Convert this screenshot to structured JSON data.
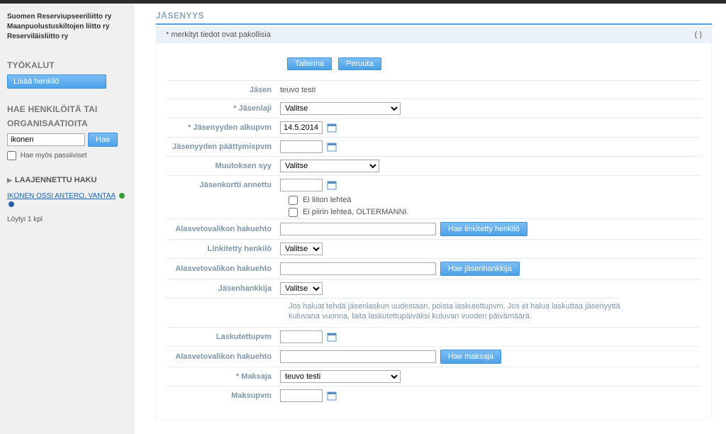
{
  "sidebar": {
    "orgs": [
      "Suomen Reserviupseeriliitto ry",
      "Maanpuolustuskiltojen liitto ry",
      "Reserviläisliitto ry"
    ],
    "tools_h": "TYÖKALUT",
    "add_person": "Lisää henkilö",
    "search_h1": "HAE HENKILÖITÄ TAI",
    "search_h2": "ORGANISAATIOITA",
    "search_value": "ikonen",
    "search_btn": "Hae",
    "passive_label": "Hae myös passiiviset",
    "advanced": "LAAJENNETTU HAKU",
    "result_link": "IKONEN OSSI ANTERO, VANTAA",
    "found": "Löytyi 1 kpl"
  },
  "page": {
    "title": "JÄSENYYS",
    "required_note": "* merkityt tiedot ovat pakollisia",
    "paren": "( )",
    "save": "Tallenna",
    "cancel": "Peruuta"
  },
  "labels": {
    "jasen": "Jäsen",
    "jasenlaji": "* Jäsenlaji",
    "alkupvm": "* Jäsenyyden alkupvm",
    "paattymispvm": "Jäsenyyden päättymispvm",
    "muutoksensyy": "Muutoksen syy",
    "kortti": "Jäsenkortti annettu",
    "alasveto": "Alasvetovalikon hakuehto",
    "linkitetty": "Linkitetty henkilö",
    "jasenhankkija": "Jäsenhankkija",
    "laskutettupvm": "Laskutettupvm",
    "maksaja": "* Maksaja",
    "maksupvm": "Maksupvm"
  },
  "values": {
    "jasen": "teuvo testi",
    "jasenlaji_sel": "Valitse",
    "alkupvm": "14.5.2014",
    "muutoksensyy_sel": "Valitse",
    "liiton_lehtea": "Ei liiton lehteä",
    "piirin_lehtea": "Ei piirin lehteä, OLTERMANNI.",
    "linkitetty_sel": "Valitse",
    "jasenhankkija_sel": "Valitse",
    "maksaja_sel": "teuvo testi",
    "note": "Jos haluat tehdä jäsenlaskun uudestaan, poista laskutettupvm. Jos et halua laskuttaa jäsenyyttä kuluvana vuonna, laita laskutettupäiväksi kuluvan vuoden päivämäärä."
  },
  "buttons": {
    "hae_linkitetty": "Hae linkitetty henkilö",
    "hae_jasenhankkija": "Hae jäsenhankkija",
    "hae_maksaja": "Hae maksaja"
  }
}
